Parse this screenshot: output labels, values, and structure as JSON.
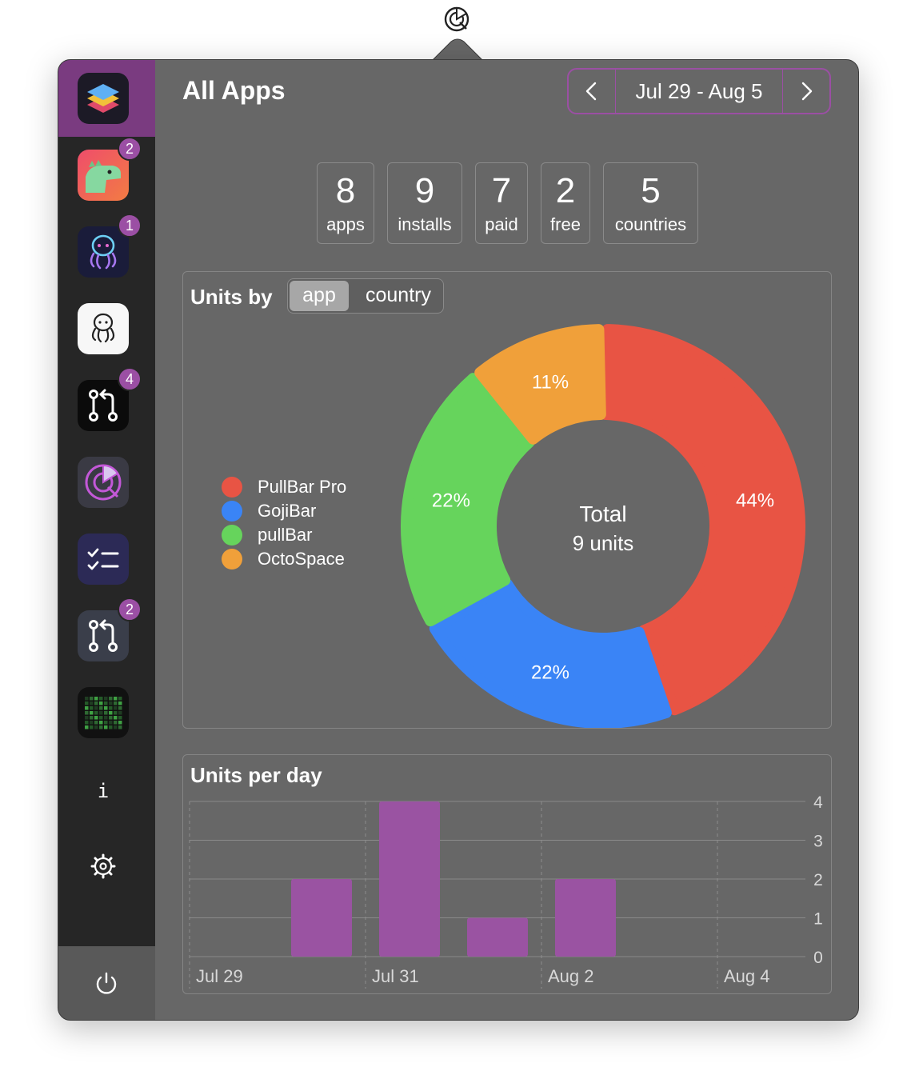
{
  "header": {
    "title": "All Apps",
    "date_range": "Jul 29 - Aug 5"
  },
  "sidebar": {
    "apps": [
      {
        "icon": "layers-app-icon",
        "badge": ""
      },
      {
        "icon": "dinosaur-app-icon",
        "badge": "2"
      },
      {
        "icon": "octopus-neon-app-icon",
        "badge": "1"
      },
      {
        "icon": "octopus-light-app-icon",
        "badge": ""
      },
      {
        "icon": "pull-request-app-icon",
        "badge": "4"
      },
      {
        "icon": "analytics-app-icon",
        "badge": ""
      },
      {
        "icon": "checklist-app-icon",
        "badge": ""
      },
      {
        "icon": "pull-request-outline-app-icon",
        "badge": "2"
      },
      {
        "icon": "contribution-grid-app-icon",
        "badge": ""
      }
    ],
    "info_label": "i"
  },
  "stats": [
    {
      "value": "8",
      "label": "apps"
    },
    {
      "value": "9",
      "label": "installs"
    },
    {
      "value": "7",
      "label": "paid"
    },
    {
      "value": "2",
      "label": "free"
    },
    {
      "value": "5",
      "label": "countries"
    }
  ],
  "units_by": {
    "title": "Units by",
    "options": [
      "app",
      "country"
    ],
    "selected": "app",
    "total_label": "Total",
    "total_value": "9 units"
  },
  "units_per_day": {
    "title": "Units per day"
  },
  "colors": {
    "accent": "#9b4fa4",
    "bar": "#9a53a2",
    "pullbar_pro": "#e85444",
    "gojibar": "#3a84f6",
    "pullbar": "#66d45c",
    "octospace": "#f0a03a"
  },
  "chart_data": [
    {
      "type": "pie",
      "categories": [
        "PullBar Pro",
        "GojiBar",
        "pullBar",
        "OctoSpace"
      ],
      "values": [
        44,
        22,
        22,
        11
      ],
      "labels": [
        "44%",
        "22%",
        "22%",
        "11%"
      ],
      "legend": "left"
    },
    {
      "type": "bar",
      "categories": [
        "Jul 29",
        "Jul 30",
        "Jul 31",
        "Aug 1",
        "Aug 2",
        "Aug 3",
        "Aug 4"
      ],
      "values": [
        0,
        2,
        4,
        1,
        2,
        0,
        0
      ],
      "x_tick_labels": [
        "Jul 29",
        "Jul 31",
        "Aug 2",
        "Aug 4"
      ],
      "y_ticks": [
        0,
        1,
        2,
        3,
        4
      ],
      "ylim": [
        0,
        4
      ],
      "grid": true
    }
  ]
}
